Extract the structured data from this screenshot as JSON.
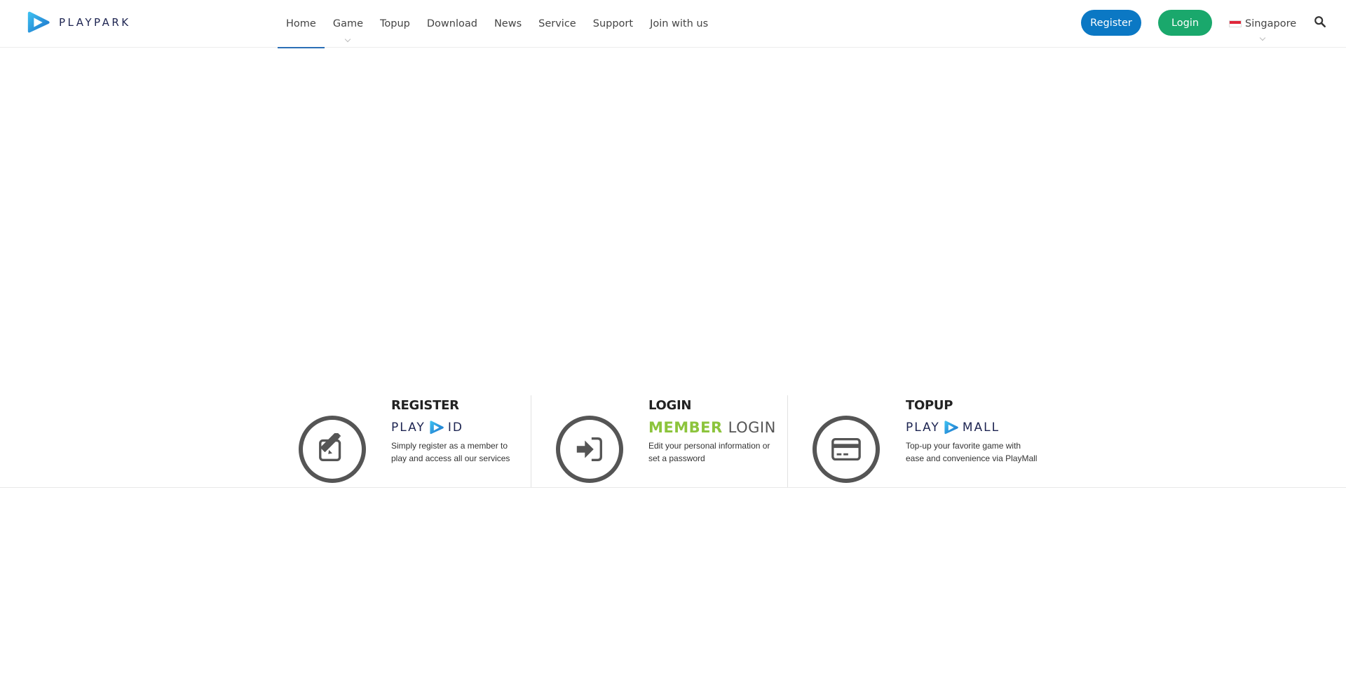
{
  "header": {
    "logo_text": "PLAYPARK",
    "nav": [
      {
        "label": "Home",
        "active": true
      },
      {
        "label": "Game",
        "dropdown": true
      },
      {
        "label": "Topup"
      },
      {
        "label": "Download"
      },
      {
        "label": "News"
      },
      {
        "label": "Service"
      },
      {
        "label": "Support"
      },
      {
        "label": "Join with us"
      }
    ],
    "register_label": "Register",
    "login_label": "Login",
    "language": "Singapore",
    "search_icon": "search-icon"
  },
  "features": [
    {
      "title": "REGISTER",
      "brand_left": "PLAY",
      "brand_right": "ID",
      "description": "Simply register as a member to play and access all our services",
      "icon": "edit-icon"
    },
    {
      "title": "LOGIN",
      "brand_left": "MEMBER",
      "brand_right": "LOGIN",
      "description": "Edit your personal information or set a password",
      "icon": "sign-in-icon"
    },
    {
      "title": "TOPUP",
      "brand_left": "PLAY",
      "brand_right": "MALL",
      "description": "Top-up your favorite game with ease and convenience via PlayMall",
      "icon": "credit-card-icon"
    }
  ],
  "colors": {
    "brand_blue": "#1d2451",
    "register_button": "#0b78c4",
    "login_button": "#1aa86c",
    "nav_active": "#2b6fb6",
    "member_green": "#8cc43c",
    "icon_gray": "#555555"
  }
}
